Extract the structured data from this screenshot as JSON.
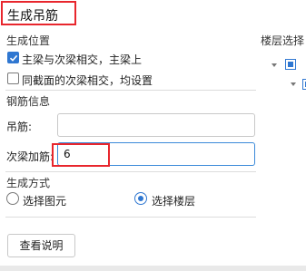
{
  "dialog": {
    "title": "生成吊筋"
  },
  "position": {
    "section_label": "生成位置",
    "option1_label": "主梁与次梁相交，主梁上",
    "option1_checked": true,
    "option2_label": "同截面的次梁相交，均设置",
    "option2_checked": false
  },
  "rebar": {
    "section_label": "钢筋信息",
    "hanger_label": "吊筋:",
    "hanger_value": "",
    "secondary_label": "次梁加筋:",
    "secondary_value": "6"
  },
  "method": {
    "section_label": "生成方式",
    "option_elements": "选择图元",
    "option_floors": "选择楼层",
    "selected": "选择楼层"
  },
  "help_button": "查看说明",
  "floor_panel": {
    "label": "楼层选择"
  },
  "colors": {
    "accent": "#2f77d1",
    "annotation": "#e8262d"
  }
}
